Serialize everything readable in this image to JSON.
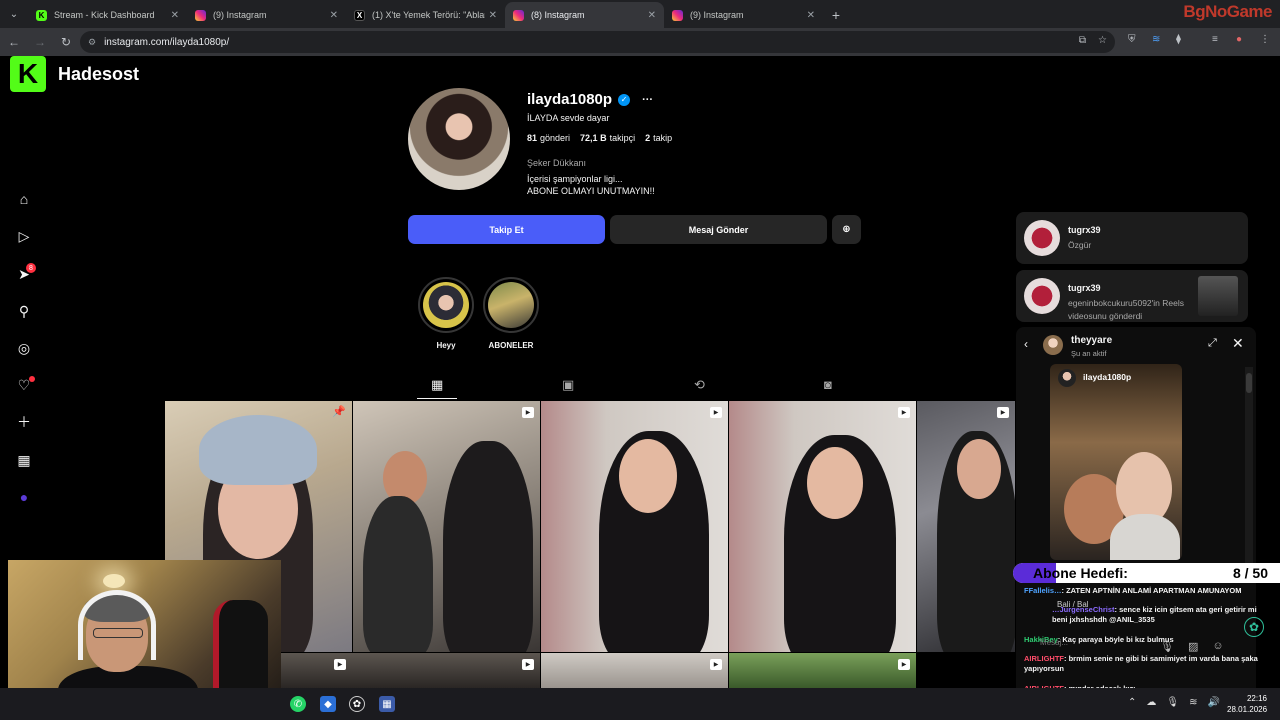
{
  "browser": {
    "tabs": [
      {
        "label": "Stream - Kick Dashboard",
        "favicon": "kick-icon",
        "active": false
      },
      {
        "label": "(9) Instagram",
        "favicon": "instagram-icon",
        "active": false
      },
      {
        "label": "(1) X'te Yemek Terörü: \"Ablam c",
        "favicon": "x-icon",
        "active": false
      },
      {
        "label": "(8) Instagram",
        "favicon": "instagram-icon",
        "active": true
      },
      {
        "label": "(9) Instagram",
        "favicon": "instagram-icon",
        "active": false
      }
    ],
    "url": "instagram.com/ilayda1080p/",
    "corner_logo": "BgNoGame"
  },
  "stream_overlay": {
    "channel_name": "Hadesost",
    "goal": {
      "label": "Abone Hedefi:",
      "count_text": "8 / 50",
      "current": 8,
      "target": 50,
      "fill_color": "#5b2cd8"
    },
    "chat": [
      {
        "user": "FFallelis…",
        "message": ": ZATEN APTNİN ANLAMİ APARTMAN AMUNAYOM",
        "user_color": "#4fa3ff"
      },
      {
        "user": "…JurgenseChrist",
        "message": ": sence kiz icin gitsem ata geri getirir mi beni jxhshshdh @ANIL_3535",
        "user_color": "#8c6cff"
      },
      {
        "user": "HakkiBey",
        "message": ": Kaç paraya böyle bi kız bulmus",
        "user_color": "#2ecc71"
      },
      {
        "user": "AIRLIGHTF",
        "message": ": brmim senie ne gibi bi samimiyet im varda bana şaka yapıyorsun",
        "user_color": "#ff4d6a"
      },
      {
        "user": "AIRLIGHTF",
        "message": ": mındar edecek kızı",
        "user_color": "#ff4d6a"
      }
    ],
    "bali_text": "Bali / Bal",
    "ghost_input": "Mesaj..."
  },
  "sidebar": {
    "items": [
      {
        "name": "home-icon",
        "glyph": "⌂"
      },
      {
        "name": "reels-icon",
        "glyph": "▷"
      },
      {
        "name": "messages-icon",
        "glyph": "➤",
        "badge": "8"
      },
      {
        "name": "search-icon",
        "glyph": "⚲"
      },
      {
        "name": "explore-icon",
        "glyph": "⊘"
      },
      {
        "name": "notifications-icon",
        "glyph": "♡",
        "dot": true
      },
      {
        "name": "create-icon",
        "glyph": "+"
      },
      {
        "name": "dashboard-icon",
        "glyph": "▦"
      },
      {
        "name": "profile-avatar",
        "glyph": "●"
      }
    ]
  },
  "profile": {
    "username": "ilayda1080p",
    "full_name": "İLAYDA sevde dayar",
    "stats": {
      "posts": "81",
      "posts_label": "gönderi",
      "followers": "72,1 B",
      "followers_label": "takipçi",
      "following": "2",
      "following_label": "takip"
    },
    "category": "Şeker Dükkanı",
    "bio": [
      "İçerisi şampiyonlar ligi...",
      "ABONE OLMAYI UNUTMAYIN!!"
    ],
    "buttons": {
      "follow": "Takip Et",
      "message": "Mesaj Gönder"
    },
    "highlights": [
      {
        "label": "Heyy"
      },
      {
        "label": "ABONELER"
      }
    ],
    "tabs": [
      "posts-grid-icon",
      "reels-icon",
      "reposts-icon",
      "tagged-icon"
    ]
  },
  "posts": [
    {
      "type": "pinned"
    },
    {
      "type": "reel"
    },
    {
      "type": "reel"
    },
    {
      "type": "reel"
    },
    {
      "type": "reel"
    },
    {
      "type": "reel"
    },
    {
      "type": "reel"
    },
    {
      "type": "reel"
    }
  ],
  "dm": {
    "notifications": [
      {
        "name": "tugrx39",
        "text": "Özgür"
      },
      {
        "name": "tugrx39",
        "text": "egeninbokcukuru5092'in Reels videosunu gönderdi"
      }
    ],
    "chat": {
      "name": "theyyare",
      "status": "Şu an aktif",
      "shared_reel_user": "ilayda1080p"
    }
  },
  "taskbar": {
    "time": "22:16",
    "date": "28.01.2026"
  }
}
